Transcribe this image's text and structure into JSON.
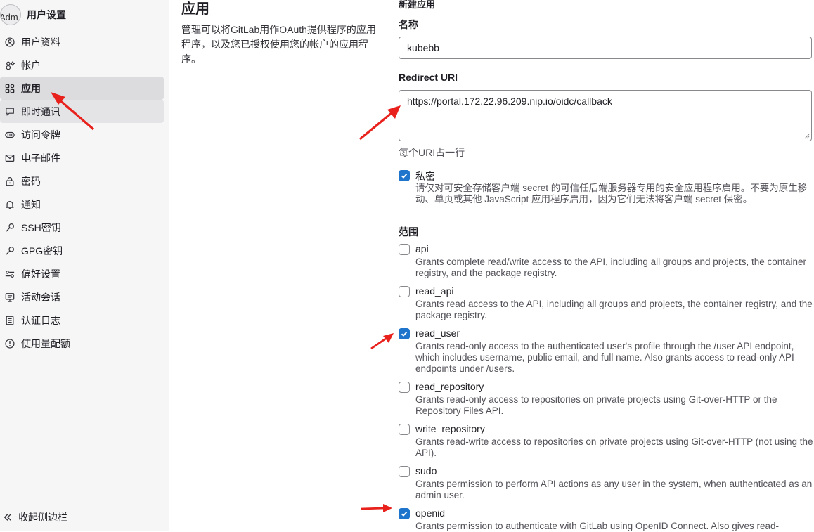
{
  "sidebar": {
    "avatar_alt": "Adm",
    "title": "用户设置",
    "items": [
      {
        "label": "用户资料",
        "icon": "profile-icon"
      },
      {
        "label": "帐户",
        "icon": "account-icon"
      },
      {
        "label": "应用",
        "icon": "applications-icon"
      },
      {
        "label": "即时通讯",
        "icon": "chat-icon"
      },
      {
        "label": "访问令牌",
        "icon": "token-icon"
      },
      {
        "label": "电子邮件",
        "icon": "mail-icon"
      },
      {
        "label": "密码",
        "icon": "lock-icon"
      },
      {
        "label": "通知",
        "icon": "bell-icon"
      },
      {
        "label": "SSH密钥",
        "icon": "key-icon"
      },
      {
        "label": "GPG密钥",
        "icon": "key-icon"
      },
      {
        "label": "偏好设置",
        "icon": "preferences-icon"
      },
      {
        "label": "活动会话",
        "icon": "monitor-icon"
      },
      {
        "label": "认证日志",
        "icon": "log-icon"
      },
      {
        "label": "使用量配额",
        "icon": "quota-icon"
      }
    ],
    "active_item": "应用",
    "collapse_label": "收起侧边栏"
  },
  "description": {
    "title": "应用",
    "text": "管理可以将GitLab用作OAuth提供程序的应用程序，以及您已授权使用您的帐户的应用程序。"
  },
  "form": {
    "header": "新建应用",
    "name_label": "名称",
    "name_value": "kubebb",
    "redirect_label": "Redirect URI",
    "redirect_value": "https://portal.172.22.96.209.nip.io/oidc/callback",
    "redirect_help": "每个URI占一行",
    "confidential": {
      "label": "私密",
      "checked": true,
      "help": "请仅对可安全存储客户端 secret 的可信任后端服务器专用的安全应用程序启用。不要为原生移动、单页或其他 JavaScript 应用程序启用，因为它们无法将客户端 secret 保密。"
    },
    "scopes_label": "范围",
    "scopes": [
      {
        "name": "api",
        "checked": false,
        "help": "Grants complete read/write access to the API, including all groups and projects, the container registry, and the package registry."
      },
      {
        "name": "read_api",
        "checked": false,
        "help": "Grants read access to the API, including all groups and projects, the container registry, and the package registry."
      },
      {
        "name": "read_user",
        "checked": true,
        "help": "Grants read-only access to the authenticated user's profile through the /user API endpoint, which includes username, public email, and full name. Also grants access to read-only API endpoints under /users."
      },
      {
        "name": "read_repository",
        "checked": false,
        "help": "Grants read-only access to repositories on private projects using Git-over-HTTP or the Repository Files API."
      },
      {
        "name": "write_repository",
        "checked": false,
        "help": "Grants read-write access to repositories on private projects using Git-over-HTTP (not using the API)."
      },
      {
        "name": "sudo",
        "checked": false,
        "help": "Grants permission to perform API actions as any user in the system, when authenticated as an admin user."
      },
      {
        "name": "openid",
        "checked": true,
        "help": "Grants permission to authenticate with GitLab using OpenID Connect. Also gives read-"
      }
    ]
  },
  "colors": {
    "accent": "#1f75cb",
    "annotation": "#e8211c",
    "sidebar_bg": "#f6f6f7"
  }
}
